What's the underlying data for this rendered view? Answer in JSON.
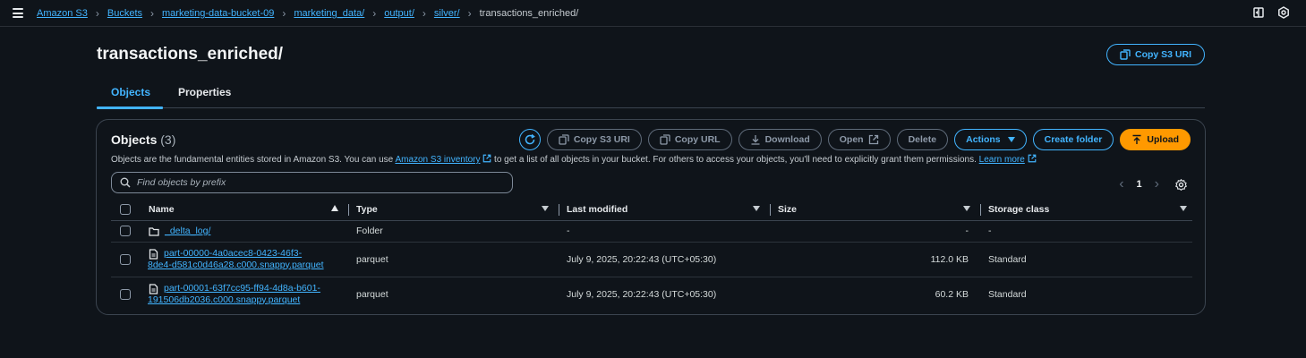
{
  "breadcrumb": {
    "items": [
      "Amazon S3",
      "Buckets",
      "marketing-data-bucket-09",
      "marketing_data/",
      "output/",
      "silver/"
    ],
    "current": "transactions_enriched/"
  },
  "header": {
    "title": "transactions_enriched/",
    "copy_uri_label": "Copy S3 URI"
  },
  "tabs": [
    {
      "label": "Objects",
      "active": true
    },
    {
      "label": "Properties",
      "active": false
    }
  ],
  "objects_panel": {
    "title": "Objects",
    "count": "(3)",
    "toolbar": {
      "copy_s3_uri": "Copy S3 URI",
      "copy_url": "Copy URL",
      "download": "Download",
      "open": "Open",
      "delete": "Delete",
      "actions": "Actions",
      "create_folder": "Create folder",
      "upload": "Upload"
    },
    "description_pre": "Objects are the fundamental entities stored in Amazon S3. You can use ",
    "inventory_link": "Amazon S3 inventory",
    "description_mid": " to get a list of all objects in your bucket. For others to access your objects, you'll need to explicitly grant them permissions. ",
    "learn_more": "Learn more",
    "search_placeholder": "Find objects by prefix",
    "page": "1"
  },
  "table": {
    "columns": [
      "Name",
      "Type",
      "Last modified",
      "Size",
      "Storage class"
    ],
    "rows": [
      {
        "name": "_delta_log/",
        "name2": "",
        "icon": "folder-icon",
        "type": "Folder",
        "last_modified": "-",
        "size": "-",
        "storage_class": "-"
      },
      {
        "name": "part-00000-4a0acec8-0423-46f3-",
        "name2": "8de4-d581c0d46a28.c000.snappy.parquet",
        "icon": "file-icon",
        "type": "parquet",
        "last_modified": "July 9, 2025, 20:22:43 (UTC+05:30)",
        "size": "112.0 KB",
        "storage_class": "Standard"
      },
      {
        "name": "part-00001-63f7cc95-ff94-4d8a-b601-",
        "name2": "191506db2036.c000.snappy.parquet",
        "icon": "file-icon",
        "type": "parquet",
        "last_modified": "July 9, 2025, 20:22:43 (UTC+05:30)",
        "size": "60.2 KB",
        "storage_class": "Standard"
      }
    ]
  },
  "colors": {
    "background": "#0f141a",
    "accent": "#42b4ff",
    "upload": "#ff9900"
  }
}
